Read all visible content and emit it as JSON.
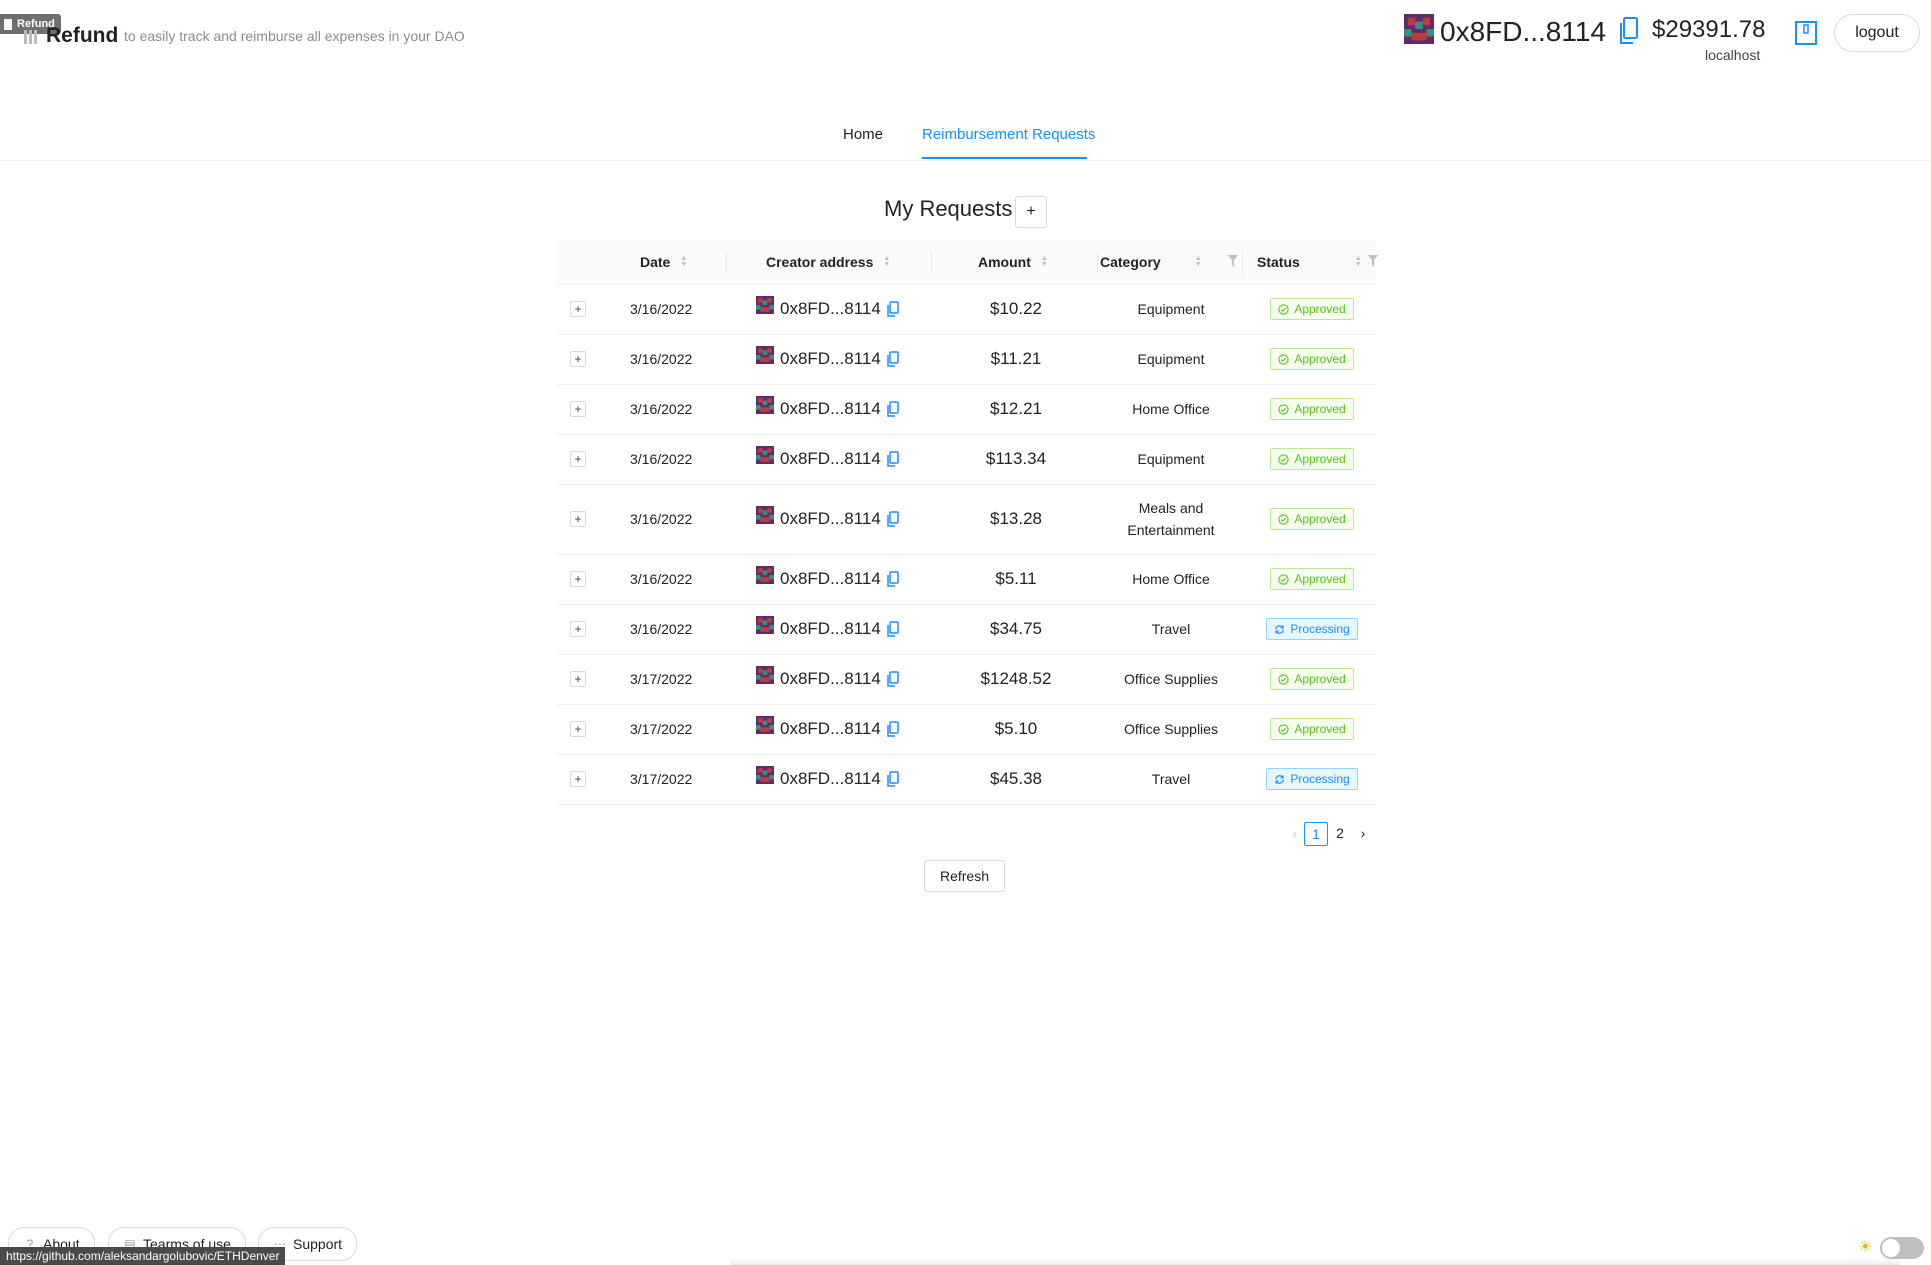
{
  "browser_tab": {
    "label": "Refund"
  },
  "header": {
    "brand": "Refund",
    "tagline": "to easily track and reimburse all expenses in your DAO",
    "address": "0x8FD...8114",
    "balance": "$29391.78",
    "network": "localhost",
    "logout_label": "logout",
    "icons": [
      "identicon-avatar",
      "copy-icon",
      "wallet-icon"
    ]
  },
  "nav": {
    "items": [
      {
        "label": "Home",
        "active": false
      },
      {
        "label": "Reimbursement Requests",
        "active": true
      }
    ]
  },
  "main": {
    "title": "My Requests",
    "add_label": "+",
    "columns": [
      "Date",
      "Creator address",
      "Amount",
      "Category",
      "Status"
    ],
    "rows": [
      {
        "date": "3/16/2022",
        "creator": "0x8FD...8114",
        "amount": "$10.22",
        "category": "Equipment",
        "status": "Approved"
      },
      {
        "date": "3/16/2022",
        "creator": "0x8FD...8114",
        "amount": "$11.21",
        "category": "Equipment",
        "status": "Approved"
      },
      {
        "date": "3/16/2022",
        "creator": "0x8FD...8114",
        "amount": "$12.21",
        "category": "Home Office",
        "status": "Approved"
      },
      {
        "date": "3/16/2022",
        "creator": "0x8FD...8114",
        "amount": "$113.34",
        "category": "Equipment",
        "status": "Approved"
      },
      {
        "date": "3/16/2022",
        "creator": "0x8FD...8114",
        "amount": "$13.28",
        "category": "Meals and Entertainment",
        "status": "Approved"
      },
      {
        "date": "3/16/2022",
        "creator": "0x8FD...8114",
        "amount": "$5.11",
        "category": "Home Office",
        "status": "Approved"
      },
      {
        "date": "3/16/2022",
        "creator": "0x8FD...8114",
        "amount": "$34.75",
        "category": "Travel",
        "status": "Processing"
      },
      {
        "date": "3/17/2022",
        "creator": "0x8FD...8114",
        "amount": "$1248.52",
        "category": "Office Supplies",
        "status": "Approved"
      },
      {
        "date": "3/17/2022",
        "creator": "0x8FD...8114",
        "amount": "$5.10",
        "category": "Office Supplies",
        "status": "Approved"
      },
      {
        "date": "3/17/2022",
        "creator": "0x8FD...8114",
        "amount": "$45.38",
        "category": "Travel",
        "status": "Processing"
      }
    ],
    "pagination": {
      "pages": [
        "1",
        "2"
      ],
      "current": "1"
    },
    "refresh_label": "Refresh"
  },
  "colors": {
    "accent": "#1890ff",
    "approved": "#52c41a",
    "processing": "#1890ff"
  },
  "footer": {
    "buttons": [
      "About",
      "Tearms of use",
      "Support"
    ],
    "status_url": "https://github.com/aleksandargolubovic/ETHDenver",
    "theme_toggle": "off"
  }
}
